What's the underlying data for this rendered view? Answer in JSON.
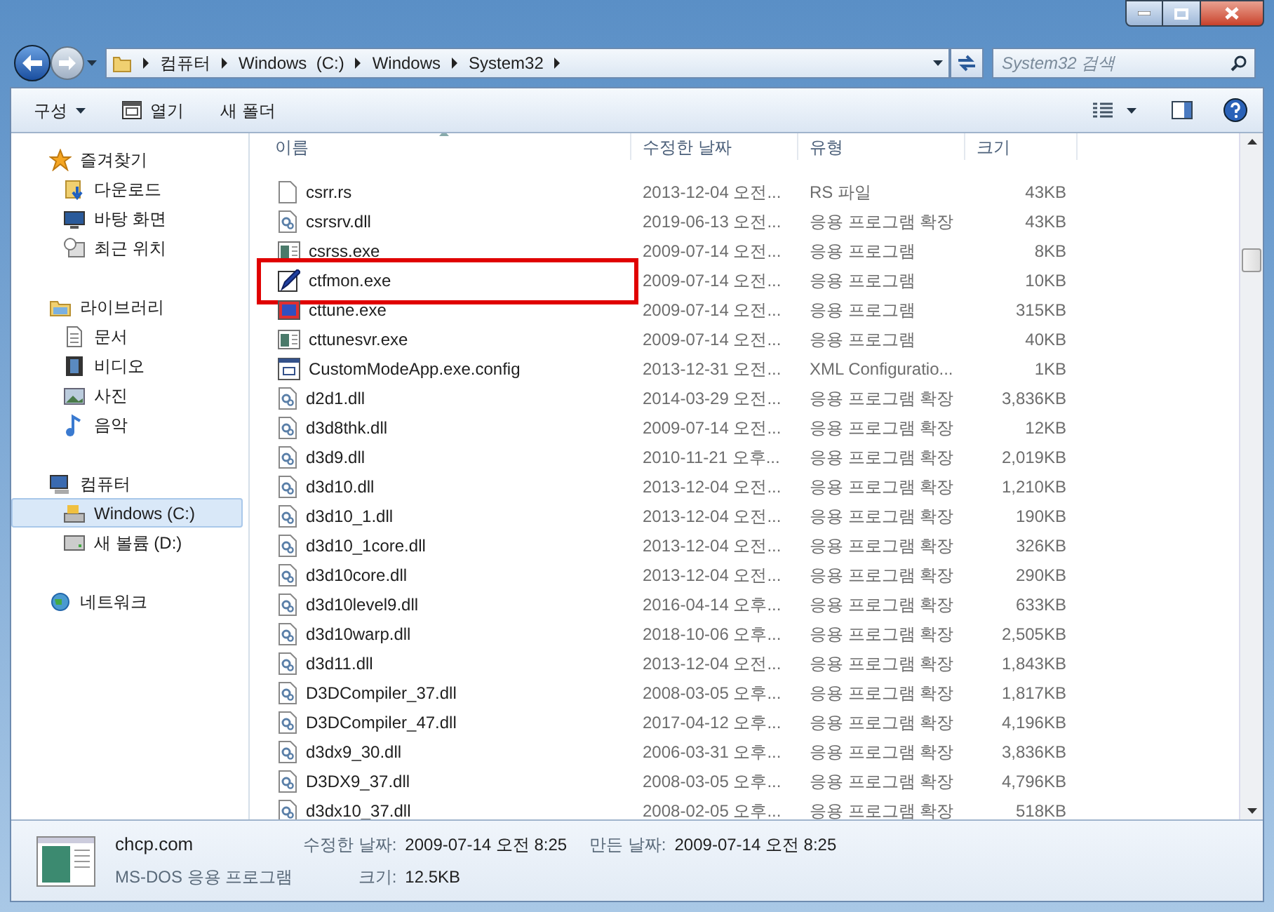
{
  "address": {
    "crumbs": [
      "컴퓨터",
      "Windows  (C:)",
      "Windows",
      "System32"
    ]
  },
  "search": {
    "placeholder": "System32 검색"
  },
  "toolbar": {
    "items": [
      {
        "label": "구성",
        "kind": "menu"
      },
      {
        "label": "열기",
        "kind": "open"
      },
      {
        "label": "새 폴더",
        "kind": "plain"
      }
    ]
  },
  "sidebar": {
    "groups": [
      {
        "label": "즐겨찾기",
        "kind": "star",
        "selected": false,
        "children": [
          {
            "label": "다운로드",
            "kind": "download",
            "selected": false
          },
          {
            "label": "바탕 화면",
            "kind": "desktop",
            "selected": false
          },
          {
            "label": "최근 위치",
            "kind": "recent",
            "selected": false
          }
        ]
      },
      {
        "label": "라이브러리",
        "kind": "library",
        "selected": false,
        "children": [
          {
            "label": "문서",
            "kind": "document",
            "selected": false
          },
          {
            "label": "비디오",
            "kind": "video",
            "selected": false
          },
          {
            "label": "사진",
            "kind": "picture",
            "selected": false
          },
          {
            "label": "음악",
            "kind": "music",
            "selected": false
          }
        ]
      },
      {
        "label": "컴퓨터",
        "kind": "computer",
        "selected": false,
        "children": [
          {
            "label": "Windows  (C:)",
            "kind": "drive",
            "selected": true
          },
          {
            "label": "새 볼륨 (D:)",
            "kind": "drive2",
            "selected": false
          }
        ]
      },
      {
        "label": "네트워크",
        "kind": "network",
        "selected": false
      }
    ]
  },
  "table": {
    "columns": [
      "이름",
      "수정한 날짜",
      "유형",
      "크기"
    ],
    "rows": [
      {
        "name": "csrr.rs",
        "date": "2013-12-04 오전...",
        "type": "RS 파일",
        "size": "43KB",
        "kind": "file",
        "highlighted": false
      },
      {
        "name": "csrsrv.dll",
        "date": "2019-06-13 오전...",
        "type": "응용 프로그램 확장",
        "size": "43KB",
        "kind": "dll",
        "highlighted": false
      },
      {
        "name": "csrss.exe",
        "date": "2009-07-14 오전...",
        "type": "응용 프로그램",
        "size": "8KB",
        "kind": "exe",
        "highlighted": false
      },
      {
        "name": "ctfmon.exe",
        "date": "2009-07-14 오전...",
        "type": "응용 프로그램",
        "size": "10KB",
        "kind": "pen",
        "highlighted": true
      },
      {
        "name": "cttune.exe",
        "date": "2009-07-14 오전...",
        "type": "응용 프로그램",
        "size": "315KB",
        "kind": "font",
        "highlighted": false
      },
      {
        "name": "cttunesvr.exe",
        "date": "2009-07-14 오전...",
        "type": "응용 프로그램",
        "size": "40KB",
        "kind": "exe",
        "highlighted": false
      },
      {
        "name": "CustomModeApp.exe.config",
        "date": "2013-12-31 오전...",
        "type": "XML Configuratio...",
        "size": "1KB",
        "kind": "config",
        "highlighted": false
      },
      {
        "name": "d2d1.dll",
        "date": "2014-03-29 오전...",
        "type": "응용 프로그램 확장",
        "size": "3,836KB",
        "kind": "dll",
        "highlighted": false
      },
      {
        "name": "d3d8thk.dll",
        "date": "2009-07-14 오전...",
        "type": "응용 프로그램 확장",
        "size": "12KB",
        "kind": "dll",
        "highlighted": false
      },
      {
        "name": "d3d9.dll",
        "date": "2010-11-21 오후...",
        "type": "응용 프로그램 확장",
        "size": "2,019KB",
        "kind": "dll",
        "highlighted": false
      },
      {
        "name": "d3d10.dll",
        "date": "2013-12-04 오전...",
        "type": "응용 프로그램 확장",
        "size": "1,210KB",
        "kind": "dll",
        "highlighted": false
      },
      {
        "name": "d3d10_1.dll",
        "date": "2013-12-04 오전...",
        "type": "응용 프로그램 확장",
        "size": "190KB",
        "kind": "dll",
        "highlighted": false
      },
      {
        "name": "d3d10_1core.dll",
        "date": "2013-12-04 오전...",
        "type": "응용 프로그램 확장",
        "size": "326KB",
        "kind": "dll",
        "highlighted": false
      },
      {
        "name": "d3d10core.dll",
        "date": "2013-12-04 오전...",
        "type": "응용 프로그램 확장",
        "size": "290KB",
        "kind": "dll",
        "highlighted": false
      },
      {
        "name": "d3d10level9.dll",
        "date": "2016-04-14 오후...",
        "type": "응용 프로그램 확장",
        "size": "633KB",
        "kind": "dll",
        "highlighted": false
      },
      {
        "name": "d3d10warp.dll",
        "date": "2018-10-06 오후...",
        "type": "응용 프로그램 확장",
        "size": "2,505KB",
        "kind": "dll",
        "highlighted": false
      },
      {
        "name": "d3d11.dll",
        "date": "2013-12-04 오전...",
        "type": "응용 프로그램 확장",
        "size": "1,843KB",
        "kind": "dll",
        "highlighted": false
      },
      {
        "name": "D3DCompiler_37.dll",
        "date": "2008-03-05 오후...",
        "type": "응용 프로그램 확장",
        "size": "1,817KB",
        "kind": "dll",
        "highlighted": false
      },
      {
        "name": "D3DCompiler_47.dll",
        "date": "2017-04-12 오후...",
        "type": "응용 프로그램 확장",
        "size": "4,196KB",
        "kind": "dll",
        "highlighted": false
      },
      {
        "name": "d3dx9_30.dll",
        "date": "2006-03-31 오후...",
        "type": "응용 프로그램 확장",
        "size": "3,836KB",
        "kind": "dll",
        "highlighted": false
      },
      {
        "name": "D3DX9_37.dll",
        "date": "2008-03-05 오후...",
        "type": "응용 프로그램 확장",
        "size": "4,796KB",
        "kind": "dll",
        "highlighted": false
      },
      {
        "name": "d3dx10_37.dll",
        "date": "2008-02-05 오후...",
        "type": "응용 프로그램 확장",
        "size": "518KB",
        "kind": "dll",
        "highlighted": false
      }
    ]
  },
  "details": {
    "name": "chcp.com",
    "type": "MS-DOS 응용 프로그램",
    "modified_label": "수정한 날짜:",
    "modified": "2009-07-14 오전 8:25",
    "created_label": "만든 날짜:",
    "created": "2009-07-14 오전 8:25",
    "size_label": "크기:",
    "size": "12.5KB"
  }
}
